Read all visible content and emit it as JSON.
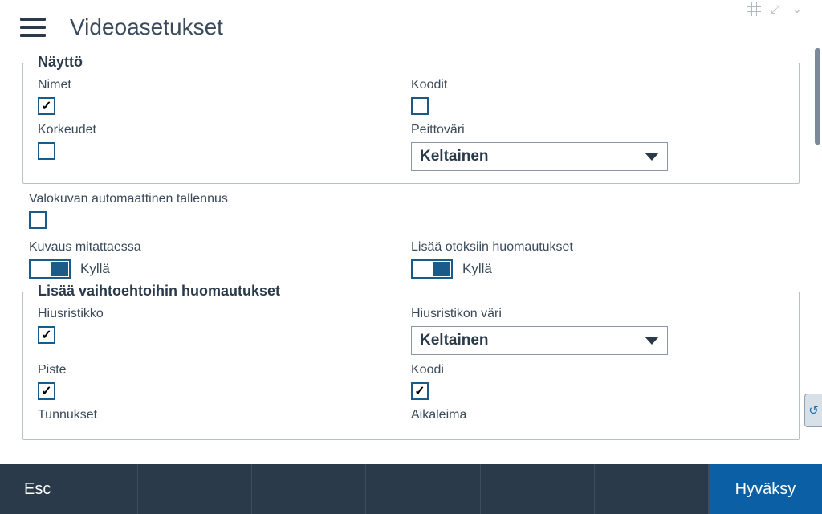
{
  "header": {
    "title": "Videoasetukset"
  },
  "top_icons": {
    "grid": "grid-icon",
    "expand": "⤢",
    "chevron": "⌄"
  },
  "display_section": {
    "legend": "Näyttö",
    "names_label": "Nimet",
    "names_checked": true,
    "codes_label": "Koodit",
    "codes_checked": false,
    "heights_label": "Korkeudet",
    "heights_checked": false,
    "coverage_color_label": "Peittoväri",
    "coverage_color_value": "Keltainen"
  },
  "auto_save": {
    "label": "Valokuvan automaattinen tallennus",
    "checked": false
  },
  "measure_desc": {
    "label": "Kuvaus mitattaessa",
    "state": "on",
    "text": "Kyllä"
  },
  "add_obs_notes": {
    "label": "Lisää otoksiin huomautukset",
    "state": "on",
    "text": "Kyllä"
  },
  "options_section": {
    "legend": "Lisää vaihtoehtoihin huomautukset",
    "crosshair_label": "Hiusristikko",
    "crosshair_checked": true,
    "crosshair_color_label": "Hiusristikon väri",
    "crosshair_color_value": "Keltainen",
    "point_label": "Piste",
    "point_checked": true,
    "code_label": "Koodi",
    "code_checked": true,
    "id_label": "Tunnukset",
    "timestamp_label": "Aikaleima"
  },
  "footer": {
    "esc": "Esc",
    "accept": "Hyväksy"
  },
  "side_tab": "↺"
}
